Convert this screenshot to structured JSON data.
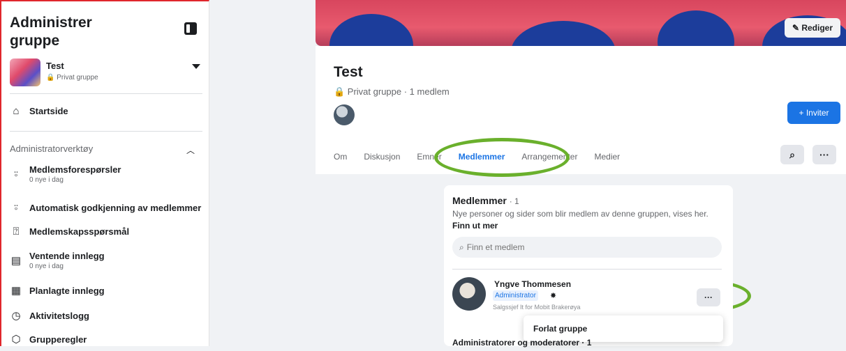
{
  "sidebar": {
    "title": "Administrer gruppe",
    "group": {
      "name": "Test",
      "privacy": "🔒 Privat gruppe"
    },
    "home": "Startside",
    "admin_tools": "Administratorverktøy",
    "items": [
      {
        "label": "Medlemsforespørsler",
        "sub": "0 nye i dag",
        "icon": "person-add-icon"
      },
      {
        "label": "Automatisk godkjenning av medlemmer",
        "icon": "person-check-icon"
      },
      {
        "label": "Medlemskapsspørsmål",
        "icon": "member-question-icon"
      },
      {
        "label": "Ventende innlegg",
        "sub": "0 nye i dag",
        "icon": "pending-post-icon"
      },
      {
        "label": "Planlagte innlegg",
        "icon": "calendar-icon"
      },
      {
        "label": "Aktivitetslogg",
        "icon": "clock-icon"
      },
      {
        "label": "Grupperegler",
        "icon": "rules-icon"
      }
    ]
  },
  "header": {
    "edit_button": "✎ Rediger",
    "group_title": "Test",
    "group_sub": "🔒 Privat gruppe · 1 medlem",
    "invite_button": "+ Inviter",
    "tabs": [
      "Om",
      "Diskusjon",
      "Emner",
      "Medlemmer",
      "Arrangementer",
      "Medier"
    ],
    "active_tab": "Medlemmer",
    "more_button": "···"
  },
  "members_card": {
    "title": "Medlemmer",
    "count": "· 1",
    "description": "Nye personer og sider som blir medlem av denne gruppen, vises her.",
    "learn_more": "Finn ut mer",
    "search_placeholder": "Finn et medlem",
    "member": {
      "name": "Yngve Thommesen",
      "badge": "Administrator",
      "role": "Salgssjef It for Mobit Brakerøya",
      "more_button": "···"
    },
    "dropdown_item": "Forlat gruppe",
    "admins_heading": "Administratorer og moderatorer · 1"
  },
  "colors": {
    "accent": "#1b74e4",
    "highlight": "#6ab02c",
    "cover": "#d8465e"
  }
}
